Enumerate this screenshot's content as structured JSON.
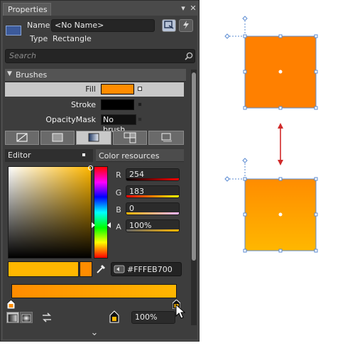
{
  "panel": {
    "tab_title": "Properties",
    "pin_glyph": "▾",
    "close_glyph": "✕",
    "name_label": "Name",
    "name_value": "<No Name>",
    "type_label": "Type",
    "type_value": "Rectangle",
    "search_placeholder": "Search",
    "section_title": "Brushes",
    "fill_label": "Fill",
    "stroke_label": "Stroke",
    "opacity_mask_label": "OpacityMask",
    "opacity_mask_value": "No brush",
    "editor_label": "Editor",
    "color_resources_label": "Color resources",
    "r_label": "R",
    "r_value": "254",
    "r_fraction": 0.996,
    "g_label": "G",
    "g_value": "183",
    "g_fraction": 0.718,
    "b_label": "B",
    "b_value": "0",
    "b_fraction": 0.0,
    "a_label": "A",
    "a_value": "100%",
    "a_fraction": 1.0,
    "hex_value": "#FFFEB700",
    "stop_offset_value": "100%",
    "expand_glyph": "⌄"
  },
  "colors": {
    "accent_orange": "#ff8c00",
    "gradient_top": "#ff8c00",
    "gradient_bottom": "#ffb700",
    "selection_blue": "#5b8bd2",
    "arrow_red": "#d02a2a"
  }
}
